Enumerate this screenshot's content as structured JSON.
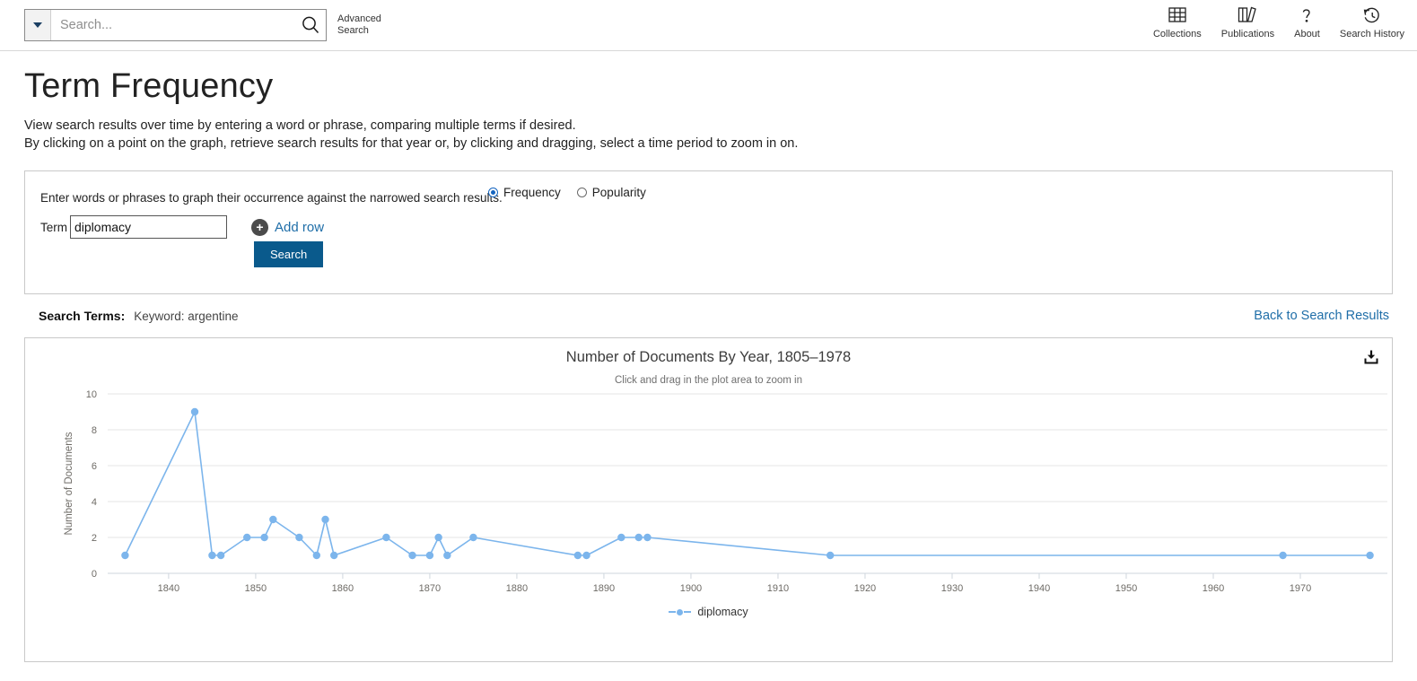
{
  "topbar": {
    "search_placeholder": "Search...",
    "dropdown_icon": "chevron-down-icon",
    "search_icon": "search-icon",
    "advanced_search": "Advanced Search",
    "nav": [
      {
        "label": "Collections",
        "icon": "grid-icon"
      },
      {
        "label": "Publications",
        "icon": "books-icon"
      },
      {
        "label": "About",
        "icon": "question-mark-icon"
      },
      {
        "label": "Search History",
        "icon": "history-clock-icon"
      }
    ]
  },
  "page": {
    "title": "Term Frequency",
    "desc_line_1": "View search results over time by entering a word or phrase, comparing multiple terms if desired.",
    "desc_line_2": "By clicking on a point on the graph, retrieve search results for that year or, by clicking and dragging, select a time period to zoom in on."
  },
  "query_panel": {
    "hint": "Enter words or phrases to graph their occurrence against the narrowed search results.",
    "term_label": "Term",
    "term_value": "diplomacy",
    "term_placeholder": "",
    "add_row_label": "Add row",
    "add_row_icon": "plus-circle-icon",
    "search_button": "Search",
    "mode_options": [
      {
        "label": "Frequency",
        "selected": true
      },
      {
        "label": "Popularity",
        "selected": false
      }
    ]
  },
  "results_bar": {
    "terms_label": "Search Terms:",
    "terms_value": "Keyword: argentine",
    "back_link": "Back to Search Results"
  },
  "chart_card": {
    "download_icon": "download-icon"
  },
  "chart_data": {
    "type": "line",
    "title": "Number of Documents By Year, 1805–1978",
    "subtitle": "Click and drag in the plot area to zoom in",
    "xlabel": "",
    "ylabel": "Number of Documents",
    "xlim": [
      1833,
      1980
    ],
    "ylim": [
      0,
      10
    ],
    "yticks": [
      0,
      2,
      4,
      6,
      8,
      10
    ],
    "xticks": [
      1840,
      1850,
      1860,
      1870,
      1880,
      1890,
      1900,
      1910,
      1920,
      1930,
      1940,
      1950,
      1960,
      1970
    ],
    "grid": "horizontal",
    "legend_position": "bottom",
    "color": "#7cb5ec",
    "series": [
      {
        "name": "diplomacy",
        "x": [
          1835,
          1843,
          1845,
          1846,
          1849,
          1851,
          1852,
          1855,
          1857,
          1858,
          1859,
          1865,
          1868,
          1870,
          1871,
          1872,
          1875,
          1887,
          1888,
          1892,
          1894,
          1895,
          1916,
          1968,
          1978
        ],
        "values": [
          1,
          9,
          1,
          1,
          2,
          2,
          3,
          2,
          1,
          3,
          1,
          2,
          1,
          1,
          2,
          1,
          2,
          1,
          1,
          2,
          2,
          2,
          1,
          1,
          1
        ]
      }
    ]
  }
}
